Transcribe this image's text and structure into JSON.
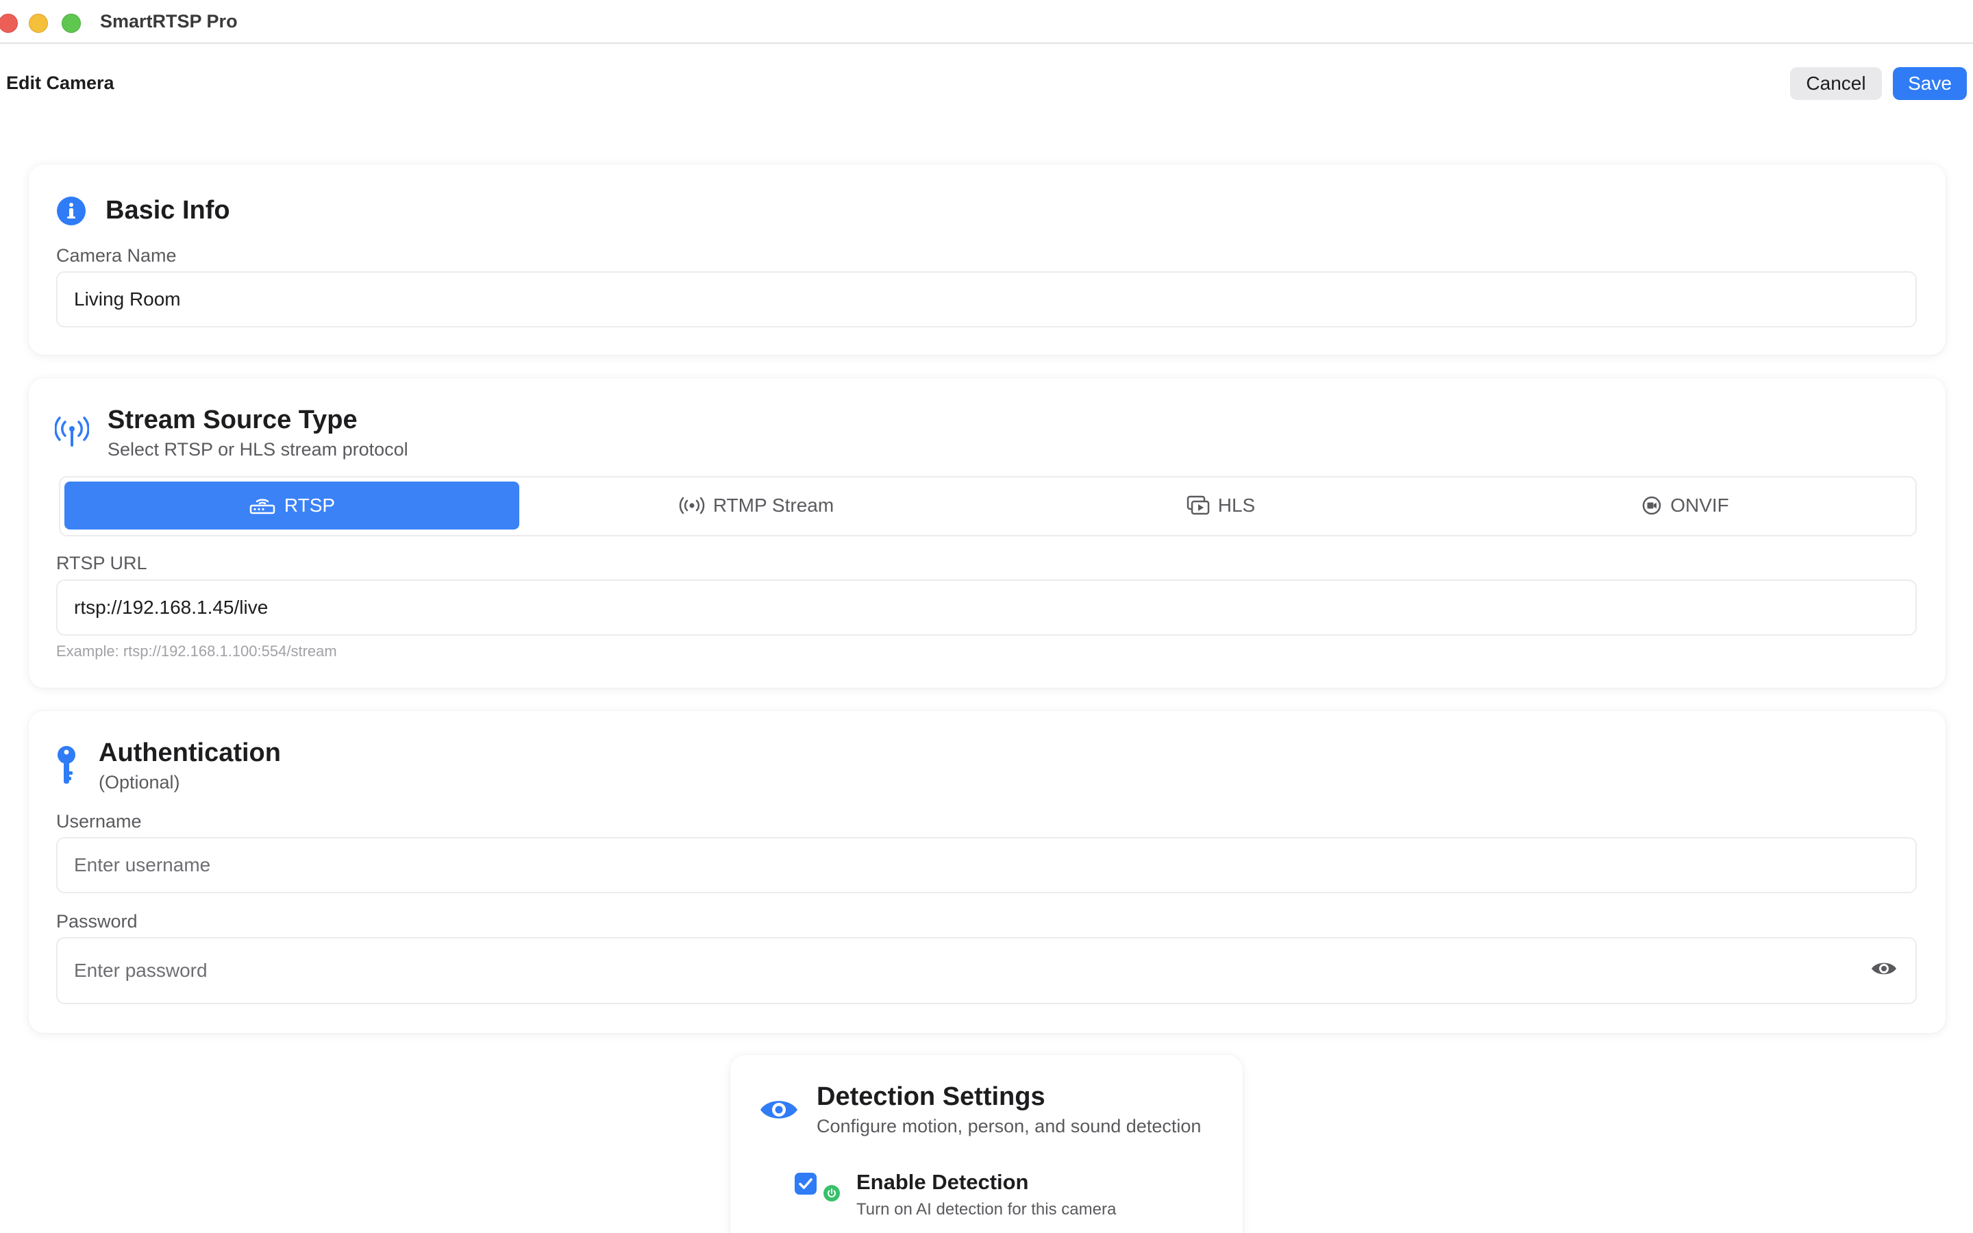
{
  "app": {
    "title": "SmartRTSP Pro"
  },
  "header": {
    "title": "Edit Camera",
    "cancel_label": "Cancel",
    "save_label": "Save"
  },
  "colors": {
    "accent": "#2f7cf6",
    "success": "#38c169"
  },
  "basic_info": {
    "title": "Basic Info",
    "icon": "info-icon",
    "camera_name_label": "Camera Name",
    "camera_name_value": "Living Room"
  },
  "stream_source": {
    "title": "Stream Source Type",
    "subtitle": "Select RTSP or HLS stream protocol",
    "icon": "antenna-icon",
    "options": [
      {
        "label": "RTSP",
        "icon": "router-icon",
        "selected": true
      },
      {
        "label": "RTMP Stream",
        "icon": "broadcast-icon",
        "selected": false
      },
      {
        "label": "HLS",
        "icon": "video-stack-icon",
        "selected": false
      },
      {
        "label": "ONVIF",
        "icon": "camera-record-icon",
        "selected": false
      }
    ],
    "url_label": "RTSP URL",
    "url_value": "rtsp://192.168.1.45/live",
    "url_hint": "Example: rtsp://192.168.1.100:554/stream"
  },
  "authentication": {
    "title": "Authentication",
    "subtitle": "(Optional)",
    "icon": "key-icon",
    "username_label": "Username",
    "username_placeholder": "Enter username",
    "password_label": "Password",
    "password_placeholder": "Enter password"
  },
  "detection": {
    "title": "Detection Settings",
    "subtitle": "Configure motion, person, and sound detection",
    "icon": "eye-icon",
    "enable_label": "Enable Detection",
    "enable_description": "Turn on AI detection for this camera",
    "enabled": true
  }
}
